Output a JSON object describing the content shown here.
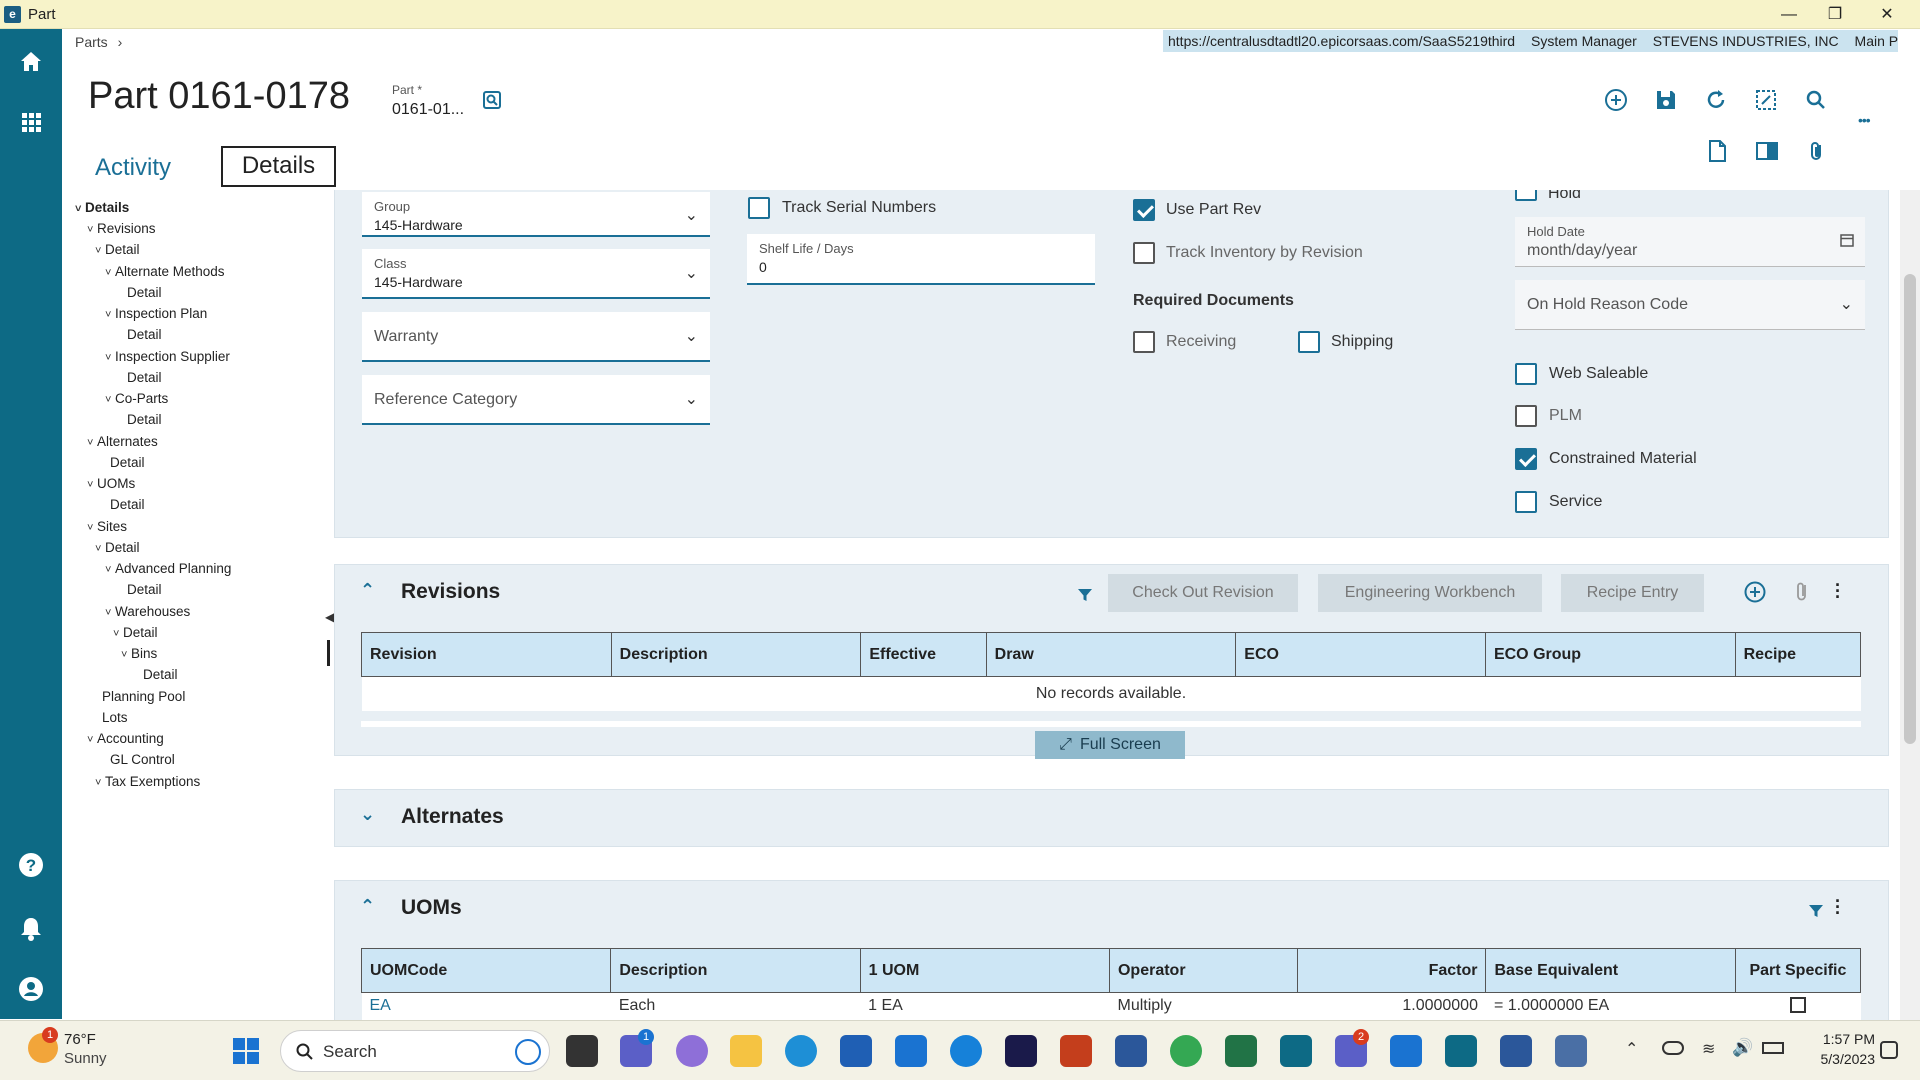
{
  "window": {
    "title": "Part",
    "controls": [
      "—",
      "❐",
      "✕"
    ]
  },
  "breadcrumb": {
    "label": "Parts",
    "separator": "›"
  },
  "environment": {
    "url": "https://centralusdtadtl20.epicorsaas.com/SaaS5219third",
    "user": "System Manager",
    "company": "STEVENS INDUSTRIES, INC",
    "plant": "Main Plant"
  },
  "header": {
    "title": "Part 0161-0178",
    "key_label": "Part *",
    "key_value": "0161-01...",
    "more": "•••"
  },
  "tabs": {
    "activity": "Activity",
    "details": "Details"
  },
  "tree": [
    {
      "label": "Details",
      "chevron": true,
      "bold": true
    },
    {
      "label": "Revisions",
      "chevron": true
    },
    {
      "label": "Detail",
      "chevron": true
    },
    {
      "label": "Alternate Methods",
      "chevron": true
    },
    {
      "label": "Detail",
      "chevron": false
    },
    {
      "label": "Inspection Plan",
      "chevron": true
    },
    {
      "label": "Detail",
      "chevron": false
    },
    {
      "label": "Inspection Supplier",
      "chevron": true
    },
    {
      "label": "Detail",
      "chevron": false
    },
    {
      "label": "Co-Parts",
      "chevron": true
    },
    {
      "label": "Detail",
      "chevron": false
    },
    {
      "label": "Alternates",
      "chevron": true
    },
    {
      "label": "Detail",
      "chevron": false
    },
    {
      "label": "UOMs",
      "chevron": true
    },
    {
      "label": "Detail",
      "chevron": false
    },
    {
      "label": "Sites",
      "chevron": true
    },
    {
      "label": "Detail",
      "chevron": true
    },
    {
      "label": "Advanced Planning",
      "chevron": true
    },
    {
      "label": "Detail",
      "chevron": false
    },
    {
      "label": "Warehouses",
      "chevron": true
    },
    {
      "label": "Detail",
      "chevron": true
    },
    {
      "label": "Bins",
      "chevron": true
    },
    {
      "label": "Detail",
      "chevron": false
    },
    {
      "label": "Planning Pool",
      "chevron": false
    },
    {
      "label": "Lots",
      "chevron": false
    },
    {
      "label": "Accounting",
      "chevron": true
    },
    {
      "label": "GL Control",
      "chevron": false
    },
    {
      "label": "Tax Exemptions",
      "chevron": true
    }
  ],
  "detail_form": {
    "group": {
      "label": "Group",
      "value": "145-Hardware"
    },
    "class": {
      "label": "Class",
      "value": "145-Hardware"
    },
    "warranty": {
      "placeholder": "Warranty"
    },
    "reference_category": {
      "placeholder": "Reference Category"
    },
    "track_serial_numbers": {
      "label": "Track Serial Numbers",
      "checked": false
    },
    "shelf_life": {
      "label": "Shelf Life / Days",
      "value": "0"
    },
    "use_part_rev": {
      "label": "Use Part Rev",
      "checked": true
    },
    "track_inventory_by_revision": {
      "label": "Track Inventory by Revision",
      "checked": false
    },
    "required_documents": {
      "title": "Required Documents",
      "receiving": {
        "label": "Receiving",
        "checked": false
      },
      "shipping": {
        "label": "Shipping",
        "checked": false
      }
    },
    "hold": {
      "label": "Hold",
      "checked": false
    },
    "hold_date": {
      "label": "Hold Date",
      "placeholder": "month/day/year"
    },
    "on_hold_reason": {
      "placeholder": "On Hold Reason Code"
    },
    "web_saleable": {
      "label": "Web Saleable",
      "checked": false
    },
    "plm": {
      "label": "PLM",
      "checked": false
    },
    "constrained_material": {
      "label": "Constrained Material",
      "checked": true
    },
    "service": {
      "label": "Service",
      "checked": false
    }
  },
  "revisions": {
    "title": "Revisions",
    "buttons": [
      "Check Out Revision",
      "Engineering Workbench",
      "Recipe Entry"
    ],
    "columns": [
      "Revision",
      "Description",
      "Effective",
      "Draw",
      "ECO",
      "ECO Group",
      "Recipe"
    ],
    "empty_message": "No records available.",
    "full_screen": "Full Screen"
  },
  "alternates": {
    "title": "Alternates"
  },
  "uoms": {
    "title": "UOMs",
    "columns": [
      "UOMCode",
      "Description",
      "1 UOM",
      "Operator",
      "Factor",
      "Base Equivalent",
      "Part Specific"
    ],
    "rows": [
      [
        "EA",
        "Each",
        "1 EA",
        "Multiply",
        "1.0000000",
        "= 1.0000000 EA",
        ""
      ]
    ]
  },
  "taskbar": {
    "weather": {
      "temp": "76°F",
      "condition": "Sunny",
      "badge": "1"
    },
    "search_placeholder": "Search",
    "time": "1:57 PM",
    "date": "5/3/2023",
    "teams_badge": "1",
    "teams2_badge": "2"
  },
  "colors": {
    "accent": "#1a6f96",
    "rail": "#0d6a85",
    "panel": "#e8eff4",
    "header_cell": "#cde6f5"
  }
}
